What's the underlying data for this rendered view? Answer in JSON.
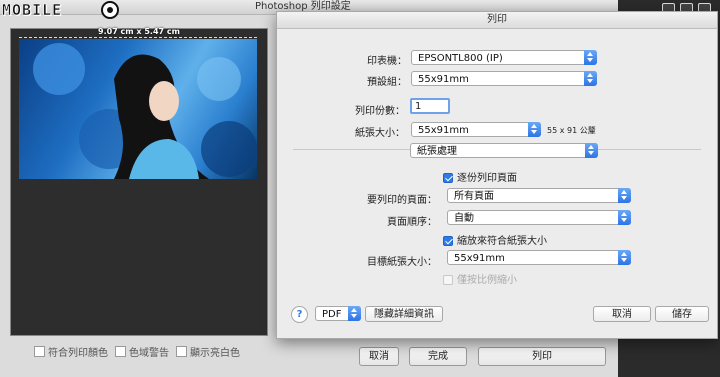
{
  "photoshop": {
    "title": "Photoshop 列印設定",
    "preview_dimensions": "9.07 cm x 5.47 cm",
    "options": {
      "match_colors": "符合列印顏色",
      "gamut_warning": "色域警告",
      "show_paper_white": "顯示亮白色"
    },
    "buttons": {
      "cancel": "取消",
      "done": "完成",
      "print": "列印"
    }
  },
  "logo": {
    "text": "MOBILE"
  },
  "dialog": {
    "title": "列印",
    "printer": {
      "label": "印表機：",
      "value": "EPSONTL800 (IP)"
    },
    "presets": {
      "label": "預設組：",
      "value": "55x91mm"
    },
    "copies": {
      "label": "列印份數：",
      "value": "1"
    },
    "paper_size": {
      "label": "紙張大小：",
      "value": "55x91mm",
      "dimensions": "55 x 91 公釐"
    },
    "panel": {
      "value": "紙張處理"
    },
    "collate": {
      "label": "逐份列印頁面",
      "checked": true
    },
    "pages_to_print": {
      "label": "要列印的頁面：",
      "value": "所有頁面"
    },
    "page_order": {
      "label": "頁面順序：",
      "value": "自動"
    },
    "scale_to_fit": {
      "label": "縮放來符合紙張大小",
      "checked": true
    },
    "destination_paper": {
      "label": "目標紙張大小：",
      "value": "55x91mm"
    },
    "scale_down_only": {
      "label": "僅按比例縮小",
      "checked": false
    },
    "pdf_button": "PDF",
    "hide_details": "隱藏詳細資訊",
    "cancel": "取消",
    "save": "儲存",
    "help": "?"
  },
  "colors": {
    "accent": "#2f7ae5",
    "dialog_bg": "#ececec",
    "ps_panel": "#2b2b2b"
  }
}
